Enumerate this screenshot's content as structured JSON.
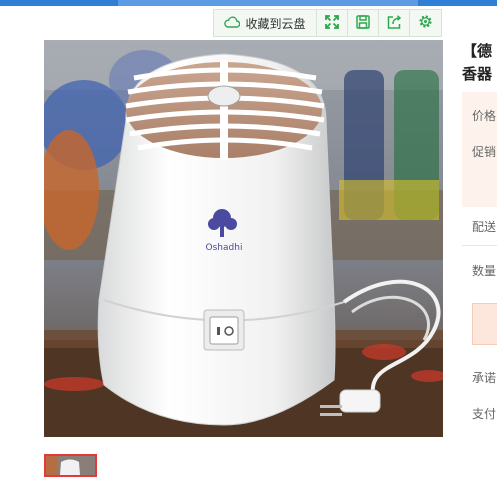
{
  "toolbar": {
    "save_label": "收藏到云盘",
    "icons": [
      "cloud-icon",
      "expand-icon",
      "save-disk-icon",
      "share-icon",
      "settings-gear-icon"
    ],
    "accent": "#2fa84f"
  },
  "product": {
    "title_line1": "【德",
    "title_line2": "香器",
    "image_brand_text": "Oshadhi"
  },
  "panel": {
    "price_label": "价格",
    "promo_label": "促销",
    "shipping_label": "配送",
    "quantity_label": "数量",
    "promise_label": "承诺",
    "payment_label": "支付"
  },
  "colors": {
    "top_bar": "#2f7fd6",
    "price_bg": "#fdf3ec",
    "thumb_border": "#e4393c"
  }
}
